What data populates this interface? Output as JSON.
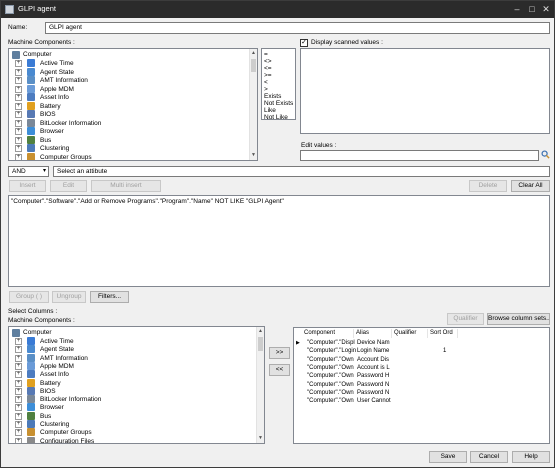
{
  "window": {
    "title": "GLPI agent",
    "minimize_icon": "minimize-icon",
    "maximize_icon": "maximize-icon",
    "close_icon": "close-icon"
  },
  "name_field": {
    "label": "Name:",
    "value": "GLPI agent"
  },
  "machine_components": {
    "label": "Machine Components :",
    "root": "Computer",
    "items": [
      {
        "label": "Active Time",
        "icon": "clock-icon",
        "color": "#3a7bd5"
      },
      {
        "label": "Agent State",
        "icon": "agent-icon",
        "color": "#4a8ad0"
      },
      {
        "label": "AMT Information",
        "icon": "chip-icon",
        "color": "#5a8fc6"
      },
      {
        "label": "Apple MDM",
        "icon": "apple-icon",
        "color": "#6a9bd8"
      },
      {
        "label": "Asset Info",
        "icon": "tag-icon",
        "color": "#4d7cc0"
      },
      {
        "label": "Battery",
        "icon": "battery-icon",
        "color": "#e0a020"
      },
      {
        "label": "BIOS",
        "icon": "bios-icon",
        "color": "#5779b4"
      },
      {
        "label": "BitLocker Information",
        "icon": "lock-icon",
        "color": "#7a8898"
      },
      {
        "label": "Browser",
        "icon": "browser-icon",
        "color": "#3d8ed8"
      },
      {
        "label": "Bus",
        "icon": "bus-icon",
        "color": "#508040"
      },
      {
        "label": "Clustering",
        "icon": "cluster-icon",
        "color": "#4c7ab8"
      },
      {
        "label": "Computer Groups",
        "icon": "group-icon",
        "color": "#c89030"
      }
    ]
  },
  "operators": [
    "=",
    "<>",
    "<=",
    ">=",
    "<",
    ">",
    "Exists",
    "Not Exists",
    "Like",
    "Not Like"
  ],
  "display_scanned": {
    "label": "Display scanned values :",
    "checked": true
  },
  "edit_values": {
    "label": "Edit values :",
    "value": ""
  },
  "condition_bar": {
    "logic": "AND",
    "attribute_placeholder": "Select an attibute"
  },
  "action_buttons": {
    "insert": "Insert",
    "edit": "Edit",
    "multi_insert": "Multi insert",
    "delete": "Delete",
    "clear_all": "Clear All"
  },
  "query_text": "\"Computer\".\"Software\".\"Add or Remove Programs\".\"Program\".\"Name\" NOT LIKE \"GLPI Agent\"",
  "group_buttons": {
    "group": "Group ( )",
    "ungroup": "Ungroup",
    "filters": "Filters..."
  },
  "select_columns": {
    "label": "Select Columns :",
    "components_label": "Machine Components :",
    "root": "Computer",
    "items": [
      {
        "label": "Active Time",
        "color": "#3a7bd5"
      },
      {
        "label": "Agent State",
        "color": "#4a8ad0"
      },
      {
        "label": "AMT Information",
        "color": "#5a8fc6"
      },
      {
        "label": "Apple MDM",
        "color": "#6a9bd8"
      },
      {
        "label": "Asset Info",
        "color": "#4d7cc0"
      },
      {
        "label": "Battery",
        "color": "#e0a020"
      },
      {
        "label": "BIOS",
        "color": "#5779b4"
      },
      {
        "label": "BitLocker Information",
        "color": "#7a8898"
      },
      {
        "label": "Browser",
        "color": "#3d8ed8"
      },
      {
        "label": "Bus",
        "color": "#508040"
      },
      {
        "label": "Clustering",
        "color": "#4c7ab8"
      },
      {
        "label": "Computer Groups",
        "color": "#c89030"
      },
      {
        "label": "Configuration Files",
        "color": "#8a8a8a"
      }
    ],
    "add_arrow": ">>",
    "remove_arrow": "<<"
  },
  "column_grid": {
    "qualifier_button": "Qualifier",
    "browse_button": "Browse column sets...",
    "headers": [
      "Component",
      "Alias",
      "Qualifier",
      "Sort Ord"
    ],
    "rows": [
      {
        "component": "\"Computer\".\"Displ",
        "alias": "Device Nam",
        "qualifier": "",
        "sort": "",
        "current": true
      },
      {
        "component": "\"Computer\".\"Login",
        "alias": "Login Name",
        "qualifier": "",
        "sort": "1",
        "current": false
      },
      {
        "component": "\"Computer\".\"Own",
        "alias": "Account Dis",
        "qualifier": "",
        "sort": "",
        "current": false
      },
      {
        "component": "\"Computer\".\"Own",
        "alias": "Account is L",
        "qualifier": "",
        "sort": "",
        "current": false
      },
      {
        "component": "\"Computer\".\"Own",
        "alias": "Password H",
        "qualifier": "",
        "sort": "",
        "current": false
      },
      {
        "component": "\"Computer\".\"Own",
        "alias": "Password N",
        "qualifier": "",
        "sort": "",
        "current": false
      },
      {
        "component": "\"Computer\".\"Own",
        "alias": "Password N",
        "qualifier": "",
        "sort": "",
        "current": false
      },
      {
        "component": "\"Computer\".\"Own",
        "alias": "User Cannot",
        "qualifier": "",
        "sort": "",
        "current": false
      }
    ]
  },
  "footer": {
    "save": "Save",
    "cancel": "Cancel",
    "help": "Help"
  },
  "colors": {
    "titlebar": "#2b2b2b",
    "window": "#f0f0f0",
    "accent": "#0078d7"
  }
}
